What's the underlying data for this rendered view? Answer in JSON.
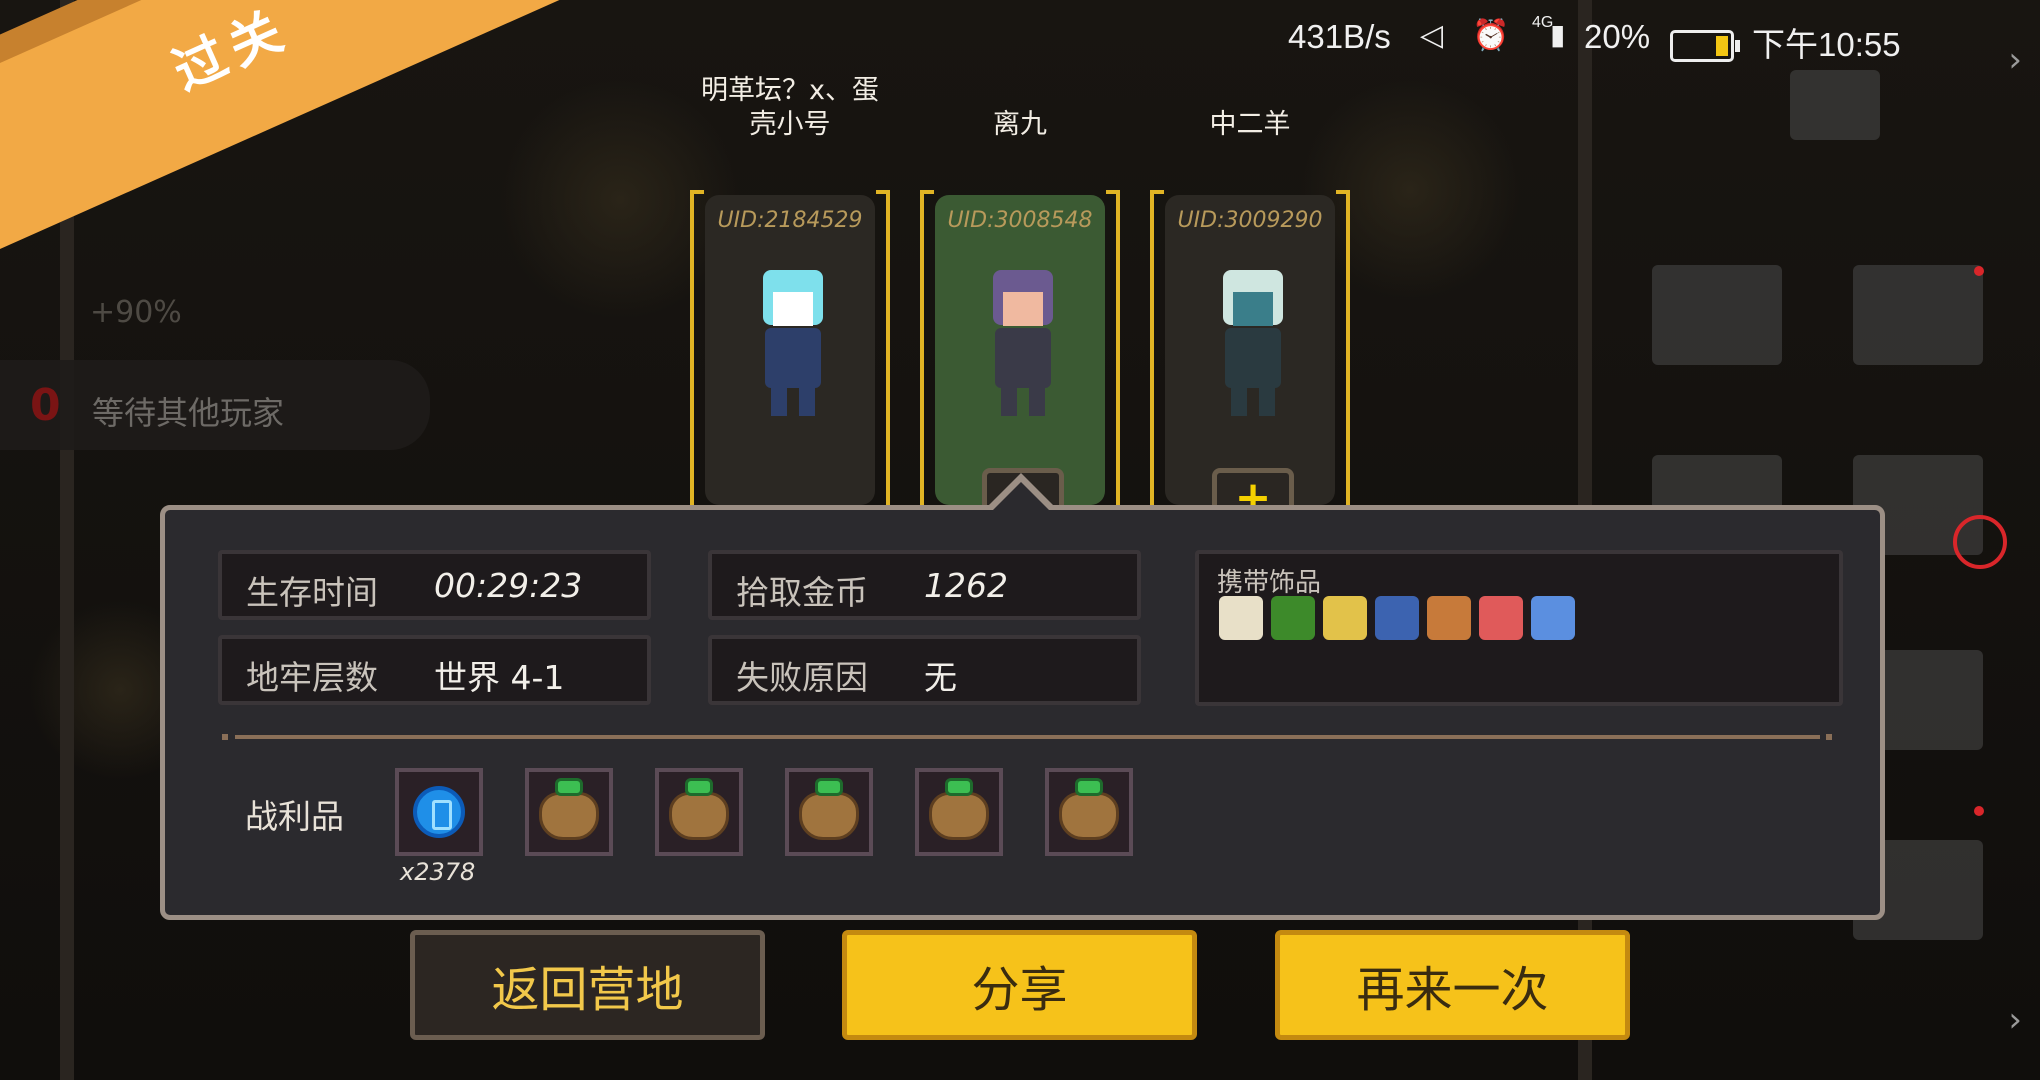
{
  "status_bar": {
    "speed": "431B/s",
    "network": "4G",
    "battery": "20%",
    "battery_level": 0.2,
    "time": "下午10:55"
  },
  "banner": {
    "text": "过关"
  },
  "left_panel": {
    "count": "0",
    "waiting_text": "等待其他玩家",
    "percent_text": "+90%"
  },
  "players": [
    {
      "name": "明革坛？x、蛋壳小号",
      "uid": "UID:2184529",
      "selected": false,
      "show_add": false,
      "character": "ice-princess-icon"
    },
    {
      "name": "离九",
      "uid": "UID:3008548",
      "selected": true,
      "show_add": true,
      "character": "officer-icon"
    },
    {
      "name": "中二羊",
      "uid": "UID:3009290",
      "selected": false,
      "show_add": true,
      "character": "priest-icon"
    }
  ],
  "add_symbol": "+",
  "stats": {
    "survival_time": {
      "label": "生存时间",
      "value": "00:29:23"
    },
    "gold": {
      "label": "拾取金币",
      "value": "1262"
    },
    "floor": {
      "label": "地牢层数",
      "value": "世界 4-1"
    },
    "fail_reason": {
      "label": "失败原因",
      "value": "无"
    }
  },
  "accessories": {
    "title": "携带饰品",
    "items": [
      {
        "name": "horn-icon",
        "color": "#e8e0c8"
      },
      {
        "name": "green-card-icon",
        "color": "#3d8a2a"
      },
      {
        "name": "gold-watch-icon",
        "color": "#e2c24a"
      },
      {
        "name": "blue-potion-icon",
        "color": "#3c63b0"
      },
      {
        "name": "vest-icon",
        "color": "#c77a3a"
      },
      {
        "name": "red-gem-icon",
        "color": "#e05a5a"
      },
      {
        "name": "blue-ring-icon",
        "color": "#5b8fe0"
      }
    ]
  },
  "loot": {
    "label": "战利品",
    "items": [
      {
        "name": "energy-orb-icon",
        "count": "x2378"
      },
      {
        "name": "seed-bag-icon"
      },
      {
        "name": "seed-bag-icon"
      },
      {
        "name": "seed-bag-icon"
      },
      {
        "name": "seed-bag-icon"
      },
      {
        "name": "seed-bag-icon"
      }
    ]
  },
  "buttons": {
    "back": "返回营地",
    "share": "分享",
    "again": "再来一次"
  }
}
